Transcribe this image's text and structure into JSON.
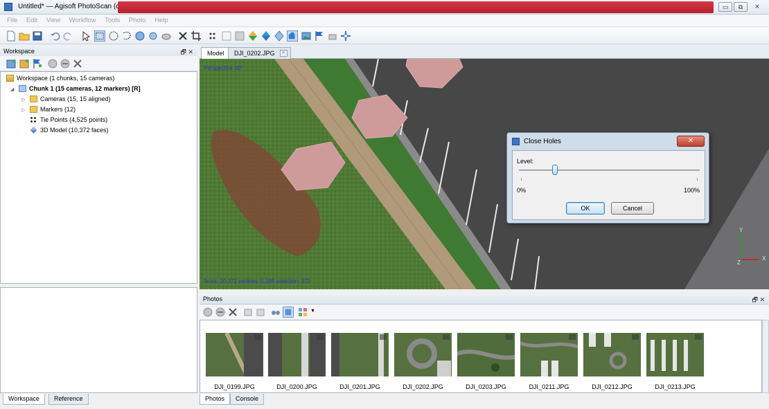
{
  "window": {
    "title": "Untitled* — Agisoft PhotoScan (demo)",
    "controls": [
      "▭",
      "⧉",
      "⨯"
    ]
  },
  "menu": [
    "File",
    "Edit",
    "View",
    "Workflow",
    "Tools",
    "Photo",
    "Help"
  ],
  "workspace": {
    "header": "Workspace",
    "header_controls": "🗗 ✕",
    "tree": {
      "root": "Workspace (1 chunks, 15 cameras)",
      "chunk": "Chunk 1 (15 cameras, 12 markers) [R]",
      "cameras": "Cameras (15, 15 aligned)",
      "markers": "Markers (12)",
      "tie_points": "Tie Points (4,525 points)",
      "model": "3D Model (10,372 faces)"
    },
    "bottom_tabs": [
      "Workspace",
      "Reference"
    ]
  },
  "view": {
    "tabs": [
      "Model",
      "DJI_0202.JPG"
    ],
    "projection": "Perspective 30°",
    "stats": "faces: 10,372 vertices: 5,188 selection: 372",
    "axis": {
      "y": "Y",
      "x": "X",
      "z": "Z"
    }
  },
  "dialog": {
    "title": "Close Holes",
    "close_label": "✕",
    "level_label": "Level:",
    "level_value": 0.2,
    "min_label": "0%",
    "max_label": "100%",
    "ok_label": "OK",
    "cancel_label": "Cancel"
  },
  "photos": {
    "header": "Photos",
    "header_controls": "🗗 ✕",
    "items": [
      {
        "name": "DJI_0199.JPG"
      },
      {
        "name": "DJI_0200.JPG"
      },
      {
        "name": "DJI_0201.JPG"
      },
      {
        "name": "DJI_0202.JPG"
      },
      {
        "name": "DJI_0203.JPG"
      },
      {
        "name": "DJI_0211.JPG"
      },
      {
        "name": "DJI_0212.JPG"
      },
      {
        "name": "DJI_0213.JPG"
      }
    ],
    "bottom_tabs": [
      "Photos",
      "Console"
    ]
  },
  "colors": {
    "title_redbar": "#c42533",
    "dialog_frame": "#cfdcea",
    "marker_fill": "#cf9a9a",
    "grass": "#4e7a34",
    "asphalt": "#4a4a4b"
  }
}
